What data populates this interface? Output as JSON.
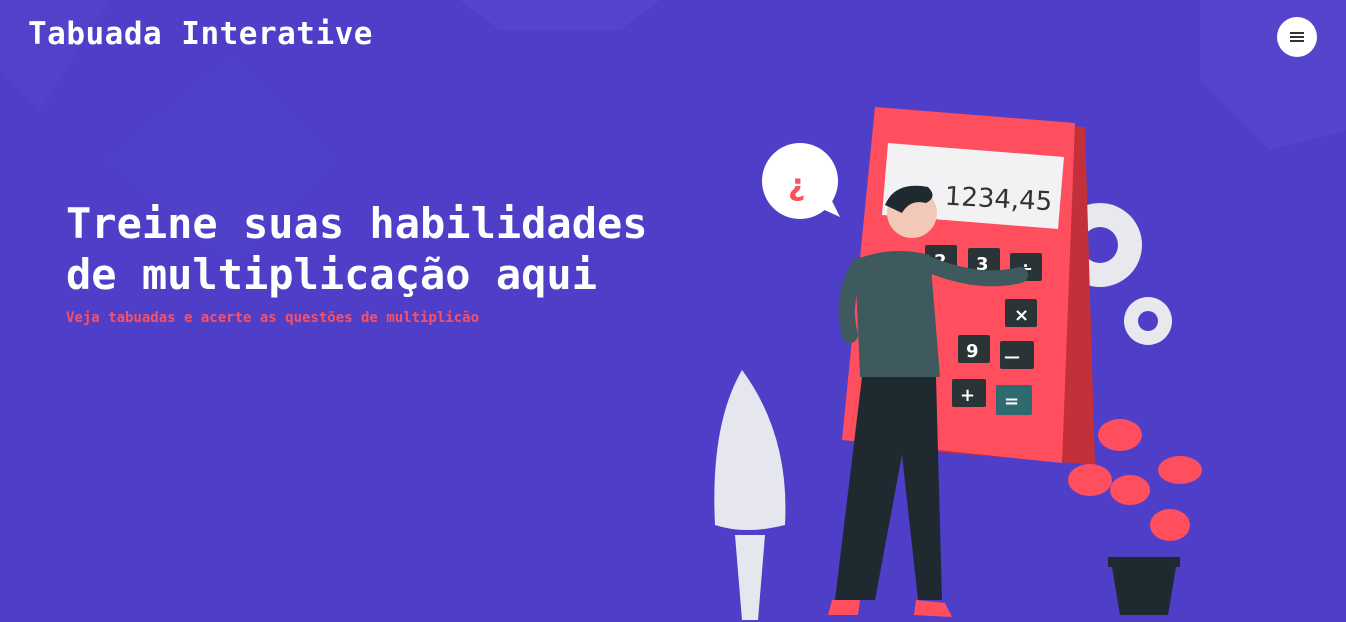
{
  "header": {
    "brand": "Tabuada Interative",
    "menu_icon": "hamburger-icon"
  },
  "hero": {
    "title": "Treine suas habilidades de multiplicação aqui",
    "subtitle": "Veja tabuadas e acerte as questões de multiplicão"
  },
  "illustration": {
    "display_value": "1234,45",
    "keys": [
      "2",
      "3",
      "÷",
      "×",
      "9",
      "—",
      "+",
      "="
    ],
    "bubble_symbol": "¿"
  },
  "colors": {
    "background": "#4f3fc8",
    "accent": "#ff4f5e",
    "text": "#ffffff"
  }
}
